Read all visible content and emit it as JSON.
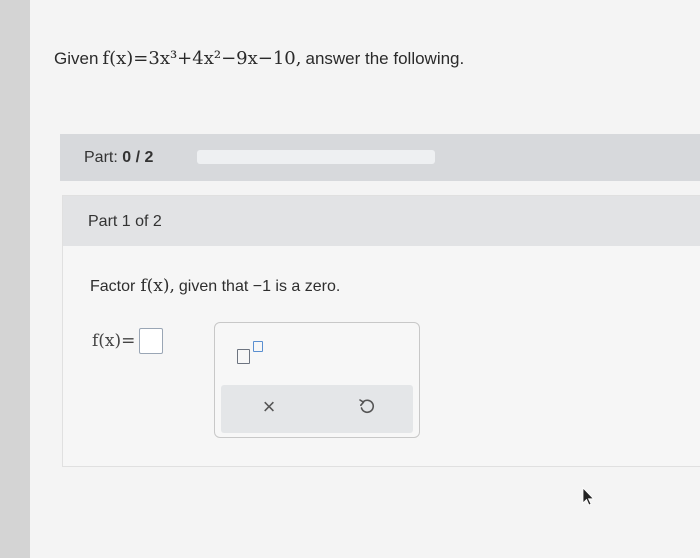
{
  "question": {
    "prefix": "Given",
    "function_expr": "f(x)=3x³+4x²−9x−10,",
    "suffix": "answer the following."
  },
  "part_progress": {
    "label": "Part:",
    "value": "0 / 2",
    "completed": 0,
    "total": 2
  },
  "part_card": {
    "header": "Part 1 of 2",
    "instruction_before": "Factor",
    "instruction_func": "f(x),",
    "instruction_after": "given that −1 is a zero.",
    "answer_label": "f(x)="
  },
  "toolbox": {
    "exponent_icon": "exponent-template-icon",
    "clear_icon": "close-icon",
    "undo_icon": "undo-icon",
    "clear_symbol": "×"
  },
  "colors": {
    "progress_fill": "#8bb34a",
    "input_border": "#9aa6b5",
    "accent_blue": "#5a8fd0"
  }
}
